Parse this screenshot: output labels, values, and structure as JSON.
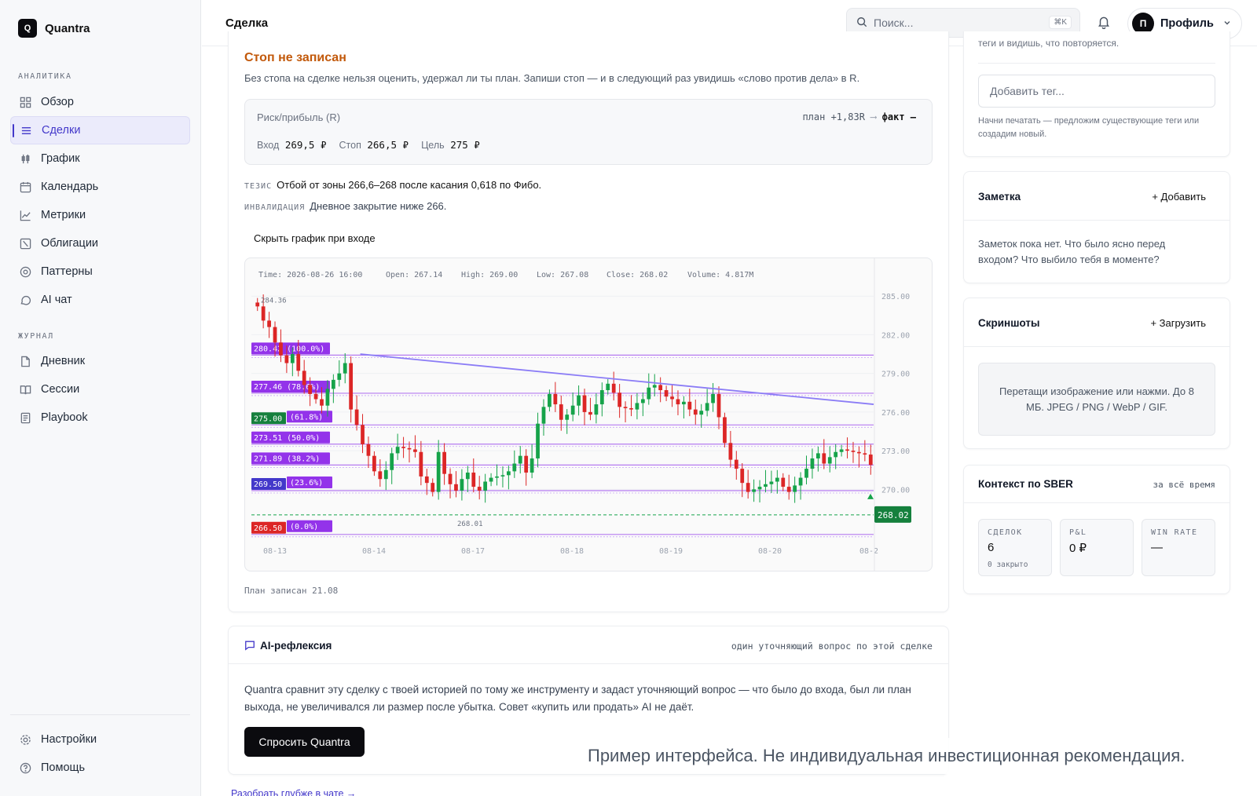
{
  "app": {
    "name": "Quantra",
    "logo_letter": "Q"
  },
  "sidebar": {
    "sections": [
      {
        "label": "АНАЛИТИКА"
      },
      {
        "label": "ЖУРНАЛ"
      }
    ],
    "items": [
      {
        "label": "Обзор",
        "icon": "grid-icon"
      },
      {
        "label": "Сделки",
        "icon": "list-icon",
        "active": true
      },
      {
        "label": "График",
        "icon": "candles-icon"
      },
      {
        "label": "Календарь",
        "icon": "calendar-icon"
      },
      {
        "label": "Метрики",
        "icon": "line-chart-icon"
      },
      {
        "label": "Облигации",
        "icon": "bond-icon"
      },
      {
        "label": "Паттерны",
        "icon": "target-icon"
      },
      {
        "label": "AI чат",
        "icon": "chat-icon"
      },
      {
        "label": "Дневник",
        "icon": "file-icon"
      },
      {
        "label": "Сессии",
        "icon": "book-icon"
      },
      {
        "label": "Playbook",
        "icon": "playbook-icon"
      }
    ],
    "footer": [
      {
        "label": "Настройки",
        "icon": "gear-icon"
      },
      {
        "label": "Помощь",
        "icon": "help-icon"
      }
    ]
  },
  "header": {
    "title": "Сделка",
    "search_placeholder": "Поиск...",
    "search_shortcut": "⌘K",
    "profile_initial": "П",
    "profile_label": "Профиль"
  },
  "trade": {
    "stop_title": "Стоп не записан",
    "stop_desc": "Без стопа на сделке нельзя оценить, удержал ли ты план. Запиши стоп — и в следующий раз увидишь «слово против дела» в R.",
    "risk_label": "Риск/прибыль (R)",
    "risk_plan_prefix": "план +1,83R",
    "risk_plan_arrow": "⟶",
    "risk_fact": "факт –",
    "entry_label": "Вход",
    "entry_value": "269,5 ₽",
    "stop_label": "Стоп",
    "stop_value": "266,5 ₽",
    "target_label": "Цель",
    "target_value": "275 ₽",
    "thesis_key": "ТЕЗИС",
    "thesis_text": "Отбой от зоны 266,6–268 после касания 0,618 по Фибо.",
    "invalid_key": "ИНВАЛИДАЦИЯ",
    "invalid_text": "Дневное закрытие ниже 266.",
    "hide_chart": "Скрыть график при входе",
    "plan_date": "План записан 21.08"
  },
  "chart_data": {
    "type": "candlestick",
    "ohlc_readout": {
      "time": "Time: 2026-08-26 16:00",
      "open": "Open: 267.14",
      "high": "High: 269.00",
      "low": "Low: 267.08",
      "close": "Close: 268.02",
      "volume": "Volume: 4.817M"
    },
    "y_ticks": [
      "285.00",
      "282.00",
      "279.00",
      "276.00",
      "273.00",
      "270.00"
    ],
    "ylim": [
      266.0,
      285.5
    ],
    "x_ticks": [
      "08-13",
      "08-14",
      "08-17",
      "08-18",
      "08-19",
      "08-20",
      "08-2"
    ],
    "last_price": "268.02",
    "high_label": "284.36",
    "low_label": "268.01",
    "fib_levels": [
      {
        "label": "280.42 (100.0%)",
        "value": 280.42
      },
      {
        "label": "277.46 (78.6%)",
        "value": 277.46
      },
      {
        "label": "(61.8%)",
        "value": 275.0,
        "tag": "275.00"
      },
      {
        "label": "273.51 (50.0%)",
        "value": 273.51
      },
      {
        "label": "271.89 (38.2%)",
        "value": 271.89
      },
      {
        "label": "(23.6%)",
        "value": 269.9,
        "tag": "269.50"
      },
      {
        "label": "(0.0%)",
        "value": 266.5,
        "tag": "266.50"
      }
    ],
    "closes": [
      284.2,
      283.1,
      282.6,
      281.4,
      280.4,
      279.8,
      280.5,
      279.2,
      278.1,
      277.4,
      277.0,
      276.5,
      277.8,
      278.5,
      279.0,
      279.8,
      276.2,
      275.0,
      273.5,
      272.6,
      271.4,
      270.8,
      271.5,
      272.8,
      273.3,
      273.2,
      273.1,
      272.9,
      271.0,
      270.5,
      269.8,
      272.9,
      271.2,
      270.4,
      269.9,
      270.8,
      271.3,
      270.2,
      269.9,
      270.6,
      270.9,
      271.0,
      271.1,
      271.4,
      272.0,
      272.6,
      271.3,
      272.4,
      275.1,
      276.4,
      277.4,
      276.6,
      275.4,
      275.8,
      276.5,
      277.3,
      276.0,
      275.8,
      276.6,
      277.7,
      278.2,
      277.5,
      276.4,
      276.3,
      276.2,
      276.7,
      277.0,
      277.9,
      278.1,
      277.7,
      277.2,
      277.0,
      276.6,
      276.8,
      276.2,
      275.8,
      276.1,
      276.7,
      277.4,
      275.6,
      273.6,
      272.3,
      271.6,
      270.5,
      269.8,
      270.0,
      270.2,
      270.4,
      270.6,
      270.9,
      270.2,
      269.8,
      270.3,
      270.9,
      271.6,
      272.4,
      272.8,
      272.0,
      272.5,
      272.9,
      273.1,
      273.0,
      272.9,
      272.8,
      272.7,
      271.9
    ],
    "trend_line": {
      "from": [
        280.5,
        0.175
      ],
      "to": [
        276.6,
        1.0
      ]
    },
    "dashed_line": 268.02
  },
  "right": {
    "tags_cut_text": "теги и видишь, что повторяется.",
    "tag_placeholder": "Добавить тег...",
    "tags_hint": "Начни печатать — предложим существующие теги или создадим новый.",
    "note_title": "Заметка",
    "note_action": "+ Добавить",
    "note_text": "Заметок пока нет. Что было ясно перед входом? Что выбило тебя в моменте?",
    "screens_title": "Скриншоты",
    "screens_action": "+ Загрузить",
    "drop_text": "Перетащи изображение или нажми. До 8 МБ. JPEG / PNG / WebP / GIF.",
    "ctx_title": "Контекст по SBER",
    "ctx_period": "за всё время",
    "stats": [
      {
        "key": "СДЕЛОК",
        "value": "6",
        "sub": "0 закрыто"
      },
      {
        "key": "P&L",
        "value": "0 ₽",
        "sub": ""
      },
      {
        "key": "WIN RATE",
        "value": "—",
        "sub": ""
      }
    ]
  },
  "ai": {
    "title": "AI-рефлексия",
    "subtitle": "один уточняющий вопрос по этой сделке",
    "text": "Quantra сравнит эту сделку с твоей историей по тому же инструменту и задаст уточняющий вопрос — что было до входа, был ли план выхода, не увеличивался ли размер после убытка. Совет «купить или продать» AI не даёт.",
    "button": "Спросить Quantra",
    "deep_link": "Разобрать глубже в чате →"
  },
  "disclaimer": "Пример интерфейса. Не индивидуальная инвестиционная рекомендация.",
  "colors": {
    "accent": "#4338ca",
    "warning": "#c2590b",
    "up": "#16a34a",
    "down": "#dc2626",
    "fib": "#a855f7"
  }
}
